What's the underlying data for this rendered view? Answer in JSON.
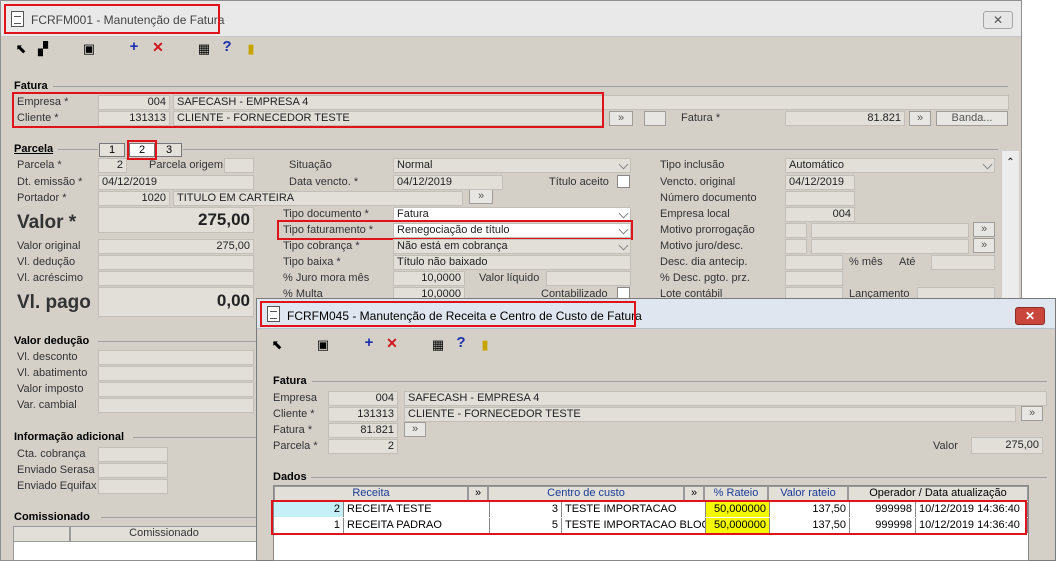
{
  "win1": {
    "title": "FCRFM001 - Manutenção de Fatura",
    "close": "✕"
  },
  "fatura": {
    "section": "Fatura",
    "empresa_label": "Empresa *",
    "empresa_code": "004",
    "empresa_name": "SAFECASH -  EMPRESA 4",
    "cliente_label": "Cliente *",
    "cliente_code": "131313",
    "cliente_name": "CLIENTE - FORNECEDOR TESTE",
    "fatura_label": "Fatura *",
    "fatura_value": "81.821",
    "banda_button": "Banda..."
  },
  "parcela": {
    "section": "Parcela",
    "tabs": [
      "1",
      "2",
      "3"
    ],
    "parcela_label": "Parcela *",
    "parcela_value": "2",
    "origem_label": "Parcela origem",
    "dt_emissao_label": "Dt. emissão *",
    "dt_emissao_value": "04/12/2019",
    "portador_label": "Portador *",
    "portador_code": "1020",
    "portador_name": "TITULO EM CARTEIRA",
    "valor_label": "Valor *",
    "valor_value": "275,00",
    "valor_original_label": "Valor original",
    "valor_original_value": "275,00",
    "vl_deducao_label": "Vl. dedução",
    "vl_acrescimo_label": "Vl. acréscimo",
    "vl_pago_label": "Vl. pago",
    "vl_pago_value": "0,00",
    "situacao_label": "Situação",
    "situacao_value": "Normal",
    "data_vencto_label": "Data vencto. *",
    "data_vencto_value": "04/12/2019",
    "titulo_aceito_label": "Título aceito",
    "tipo_doc_label": "Tipo documento *",
    "tipo_doc_value": "Fatura",
    "tipo_fat_label": "Tipo faturamento *",
    "tipo_fat_value": "Renegociação de título",
    "tipo_cob_label": "Tipo cobrança *",
    "tipo_cob_value": "Não está em cobrança",
    "tipo_baixa_label": "Tipo baixa *",
    "tipo_baixa_value": "Título não baixado",
    "juro_label": "% Juro mora mês",
    "juro_value": "10,0000",
    "valor_liquido_label": "Valor líquido",
    "multa_label": "% Multa",
    "multa_value": "10,0000",
    "contabilizado_label": "Contabilizado",
    "tipo_inclusao_label": "Tipo inclusão",
    "tipo_inclusao_value": "Automático",
    "vencto_original_label": "Vencto. original",
    "vencto_original_value": "04/12/2019",
    "numero_doc_label": "Número documento",
    "empresa_local_label": "Empresa local",
    "empresa_local_value": "004",
    "motivo_prorrog_label": "Motivo prorrogação",
    "motivo_juro_label": "Motivo juro/desc.",
    "desc_dia_label": "Desc. dia antecip.",
    "pct_mes_label": "% mês",
    "ate_label": "Até",
    "pct_desc_label": "% Desc. pgto. prz.",
    "lote_label": "Lote contábil",
    "lancamento_label": "Lançamento"
  },
  "valor_deducao": {
    "section": "Valor dedução",
    "items": [
      "Vl. desconto",
      "Vl. abatimento",
      "Valor imposto",
      "Var. cambial"
    ]
  },
  "info_adicional": {
    "section": "Informação adicional",
    "items": [
      "Cta. cobrança",
      "Enviado Serasa",
      "Enviado Equifax"
    ]
  },
  "comissionado": {
    "section": "Comissionado",
    "col": "Comissionado"
  },
  "win2": {
    "title": "FCRFM045 - Manutenção de Receita e Centro de Custo de Fatura",
    "close": "✕"
  },
  "fatura2": {
    "section": "Fatura",
    "empresa_label": "Empresa",
    "empresa_code": "004",
    "empresa_name": "SAFECASH -  EMPRESA 4",
    "cliente_label": "Cliente *",
    "cliente_code": "131313",
    "cliente_name": "CLIENTE - FORNECEDOR TESTE",
    "fatura_label": "Fatura *",
    "fatura_value": "81.821",
    "parcela_label": "Parcela *",
    "parcela_value": "2",
    "valor_label": "Valor",
    "valor_value": "275,00"
  },
  "dados": {
    "section": "Dados",
    "headers": [
      "Receita",
      "»",
      "Centro de custo",
      "»",
      "% Rateio",
      "Valor rateio",
      "Operador / Data atualização"
    ],
    "rows": [
      {
        "rc": "2",
        "rn": "RECEITA TESTE",
        "cc": "3",
        "cn": "TESTE IMPORTACAO",
        "pct": "50,000000",
        "val": "137,50",
        "op": "999998",
        "dt": "10/12/2019 14:36:40"
      },
      {
        "rc": "1",
        "rn": "RECEITA PADRAO",
        "cc": "5",
        "cn": "TESTE IMPORTACAO BLOQ",
        "pct": "50,000000",
        "val": "137,50",
        "op": "999998",
        "dt": "10/12/2019 14:36:40"
      }
    ]
  },
  "icons": {
    "tb1": [
      "select-icon",
      "copy-icon",
      "save-icon",
      "add-icon",
      "delete-icon",
      "calc-icon",
      "help-icon",
      "exit-icon"
    ]
  },
  "colors": {
    "highlight_red": "#e0121a",
    "yellow": "#f4f800"
  }
}
